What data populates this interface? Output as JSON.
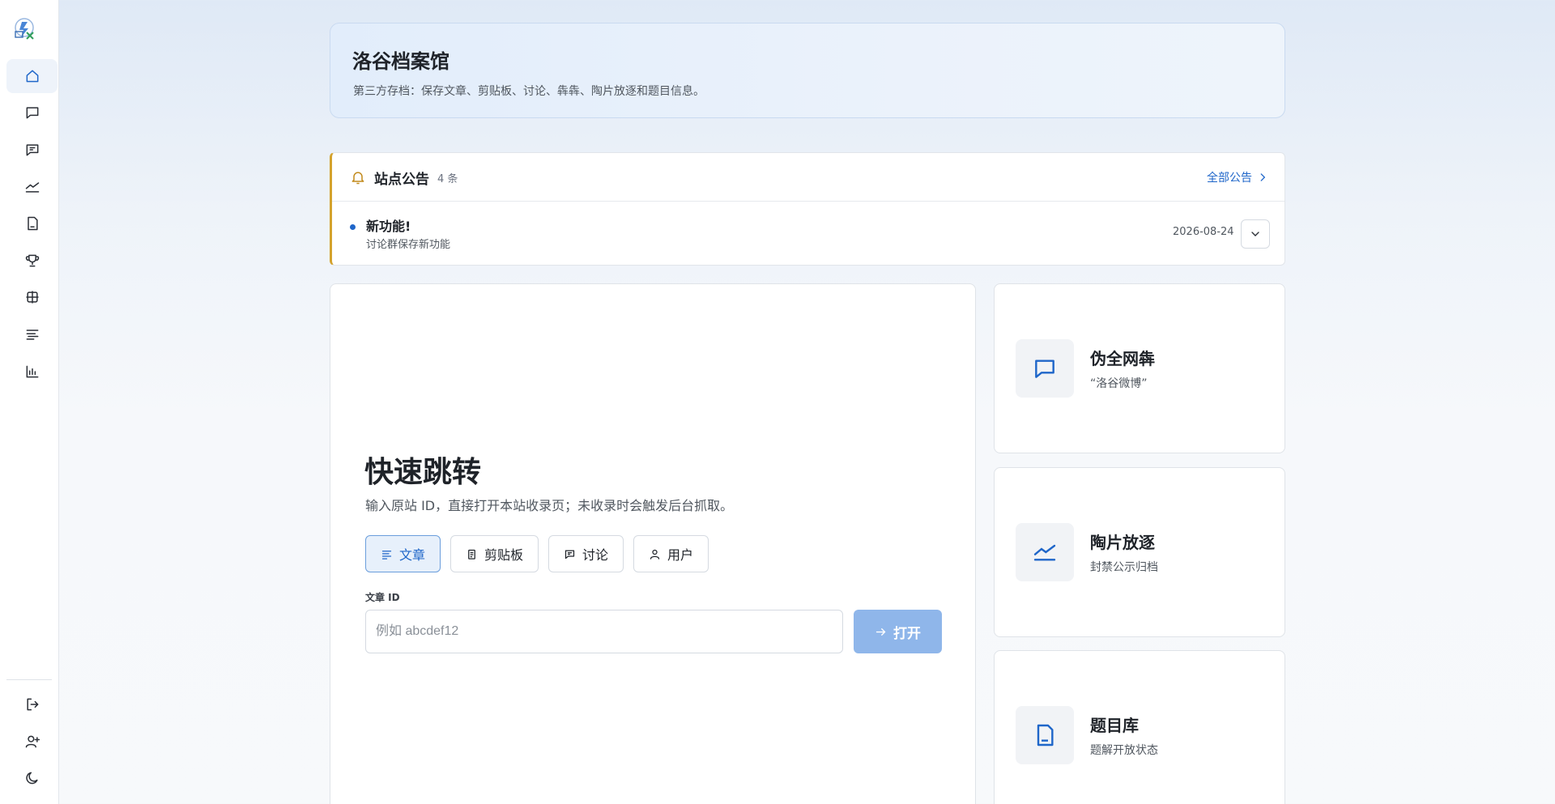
{
  "sidebar": {
    "logo": "luogu-archive-logo",
    "items": [
      {
        "name": "home",
        "icon": "home-icon",
        "active": true
      },
      {
        "name": "chat",
        "icon": "chat-icon"
      },
      {
        "name": "discussion",
        "icon": "message-lines-icon"
      },
      {
        "name": "trend",
        "icon": "trend-icon"
      },
      {
        "name": "document",
        "icon": "document-icon"
      },
      {
        "name": "trophy",
        "icon": "trophy-icon"
      },
      {
        "name": "grid",
        "icon": "grid-icon"
      },
      {
        "name": "list",
        "icon": "list-icon"
      },
      {
        "name": "chart",
        "icon": "bar-chart-icon"
      }
    ],
    "bottom": [
      {
        "name": "logout",
        "icon": "logout-icon"
      },
      {
        "name": "add-user",
        "icon": "add-user-icon"
      },
      {
        "name": "theme",
        "icon": "moon-icon"
      }
    ]
  },
  "header": {
    "title": "洛谷档案馆",
    "subtitle": "第三方存档：保存文章、剪贴板、讨论、犇犇、陶片放逐和题目信息。"
  },
  "announcements": {
    "title": "站点公告",
    "count": "4 条",
    "view_all": "全部公告",
    "item": {
      "title": "新功能!",
      "subtitle": "讨论群保存新功能",
      "date": "2026-08-24"
    }
  },
  "jump": {
    "title": "快速跳转",
    "description": "输入原站 ID，直接打开本站收录页；未收录时会触发后台抓取。",
    "tabs": [
      {
        "label": "文章",
        "icon": "text-icon",
        "active": true
      },
      {
        "label": "剪贴板",
        "icon": "clipboard-icon"
      },
      {
        "label": "讨论",
        "icon": "chat-icon"
      },
      {
        "label": "用户",
        "icon": "user-icon"
      }
    ],
    "field_label": "文章 ID",
    "placeholder": "例如 abcdef12",
    "open_label": "打开"
  },
  "features": [
    {
      "title": "伪全网犇",
      "subtitle": "“洛谷微博”",
      "icon": "chat-icon"
    },
    {
      "title": "陶片放逐",
      "subtitle": "封禁公示归档",
      "icon": "trend-icon"
    },
    {
      "title": "题目库",
      "subtitle": "题解开放状态",
      "icon": "document-icon"
    }
  ],
  "colors": {
    "accent": "#1f66c9",
    "announce_border": "#d4a22d",
    "open_button": "#8fb6ea"
  }
}
